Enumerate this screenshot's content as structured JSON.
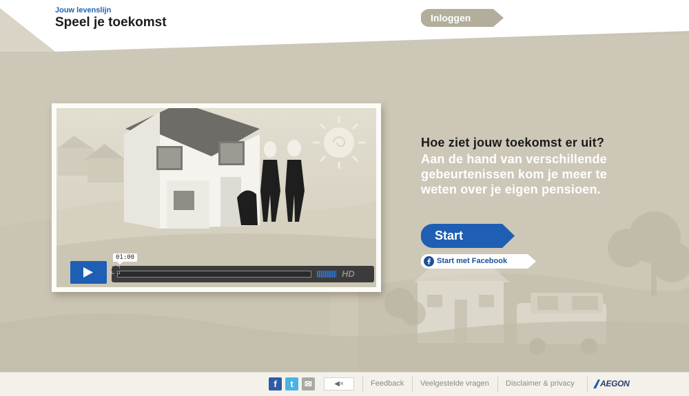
{
  "header": {
    "subtitle": "Jouw levenslijn",
    "title": "Speel je toekomst",
    "login_label": "Inloggen"
  },
  "video": {
    "time_tooltip": "01:00",
    "hd_label": "HD"
  },
  "intro": {
    "headline": "Hoe ziet jouw toekomst er uit?",
    "body": "Aan de hand van verschillende gebeurtenissen kom je meer te weten over je eigen pensioen."
  },
  "actions": {
    "start_label": "Start",
    "facebook_start_label": "Start met Facebook"
  },
  "footer": {
    "social": {
      "facebook_glyph": "f",
      "twitter_glyph": "t",
      "mail_glyph": "✉"
    },
    "mute_label": "◀×",
    "links": [
      "Feedback",
      "Veelgestelde vragen",
      "Disclaimer & privacy"
    ],
    "brand_logo_text": "AEGON"
  },
  "colors": {
    "accent_blue": "#1f5fb3",
    "login_button": "#b3ae9c",
    "background": "#cfcabb",
    "footer_bg": "#f3f1ea"
  },
  "icons": [
    "play-icon",
    "fullscreen-icon",
    "facebook-icon",
    "twitter-icon",
    "mail-icon",
    "mute-icon"
  ]
}
